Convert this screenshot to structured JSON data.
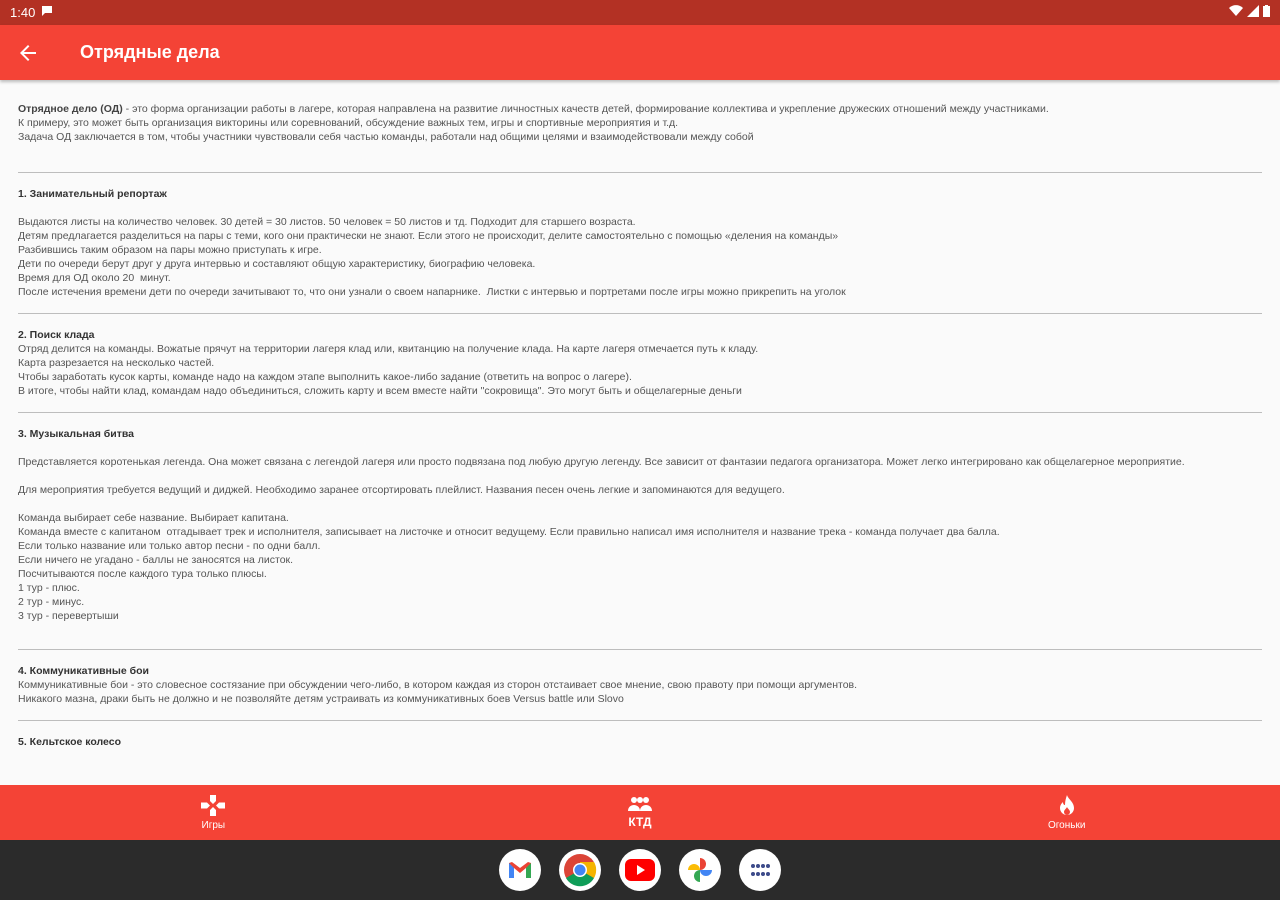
{
  "status_bar": {
    "time": "1:40"
  },
  "app_bar": {
    "title": "Отрядные дела"
  },
  "intro": {
    "term": "Отрядное дело (ОД)",
    "line1_rest": " - это форма организации работы в лагере, которая направлена на развитие личностных качеств детей, формирование коллектива и укрепление дружеских отношений между участниками.",
    "line2": "К примеру, это может быть организация викторины или соревнований, обсуждение важных тем, игры и спортивные мероприятия и т.д.",
    "line3": "Задача ОД заключается в том, чтобы участники чувствовали себя частью команды, работали над общими целями и взаимодействовали между собой"
  },
  "sections": [
    {
      "title": "1.  Занимательный репортаж",
      "lines": [
        "Выдаются листы на количество человек. 30 детей = 30 листов. 50 человек = 50 листов и тд. Подходит для старшего возраста.",
        "Детям предлагается разделиться на пары с теми, кого они практически не знают. Если этого не происходит, делите самостоятельно с помощью «деления на команды»",
        "Разбившись таким образом на пары можно приступать к игре.",
        "Дети по очереди берут друг у друга интервью и составляют общую характеристику, биографию человека.",
        "Время для ОД около 20  минут.",
        "После истечения времени дети по очереди зачитывают то, что они узнали о своем напарнике.  Листки с интервью и портретами после игры можно прикрепить на уголок"
      ]
    },
    {
      "title": "2. Поиск клада",
      "lines": [
        "Отряд делится на команды. Вожатые прячут на территории лагеря клад или, квитанцию на получение клада. На карте лагеря отмечается путь к кладу.",
        "Карта разрезается на несколько частей.",
        "Чтобы заработать кусок карты, команде надо на каждом этапе выполнить какое-либо задание (ответить на вопрос о лагере).",
        "В итоге, чтобы найти клад, командам надо объединиться, сложить карту и всем вместе найти \"сокровища\". Это могут быть и общелагерные деньги"
      ]
    },
    {
      "title": "3. Музыкальная битва",
      "p1": "Представляется коротенькая легенда. Она может связана с легендой лагеря или просто подвязана под любую другую легенду. Все зависит от фантазии педагога организатора. Может легко интегрировано как общелагерное мероприятие.",
      "p2": "Для мероприятия требуется ведущий и диджей. Необходимо заранее отсортировать плейлист. Названия песен очень легкие и запоминаются для ведущего.",
      "lines": [
        "Команда выбирает себе название. Выбирает капитана.",
        "Команда вместе с капитаном  отгадывает трек и исполнителя, записывает на листочке и относит ведущему. Если правильно написал имя исполнителя и название трека - команда получает два балла.",
        "Если только название или только автор песни - по одни балл.",
        "Если ничего не угадано - баллы не заносятся на листок.",
        "Посчитываются после каждого тура только плюсы.",
        "1 тур - плюс.",
        "2 тур - минус.",
        "3 тур - перевертыши"
      ]
    },
    {
      "title": "4. Коммуникативные бои",
      "lines": [
        "Коммуникативные бои - это словесное состязание при обсуждении чего-либо, в котором каждая из сторон отстаивает свое мнение, свою правоту при помощи аргументов.",
        "Никакого мазна, драки быть не должно и не позволяйте детям устраивать из коммуникативных боев Versus battle или Slovo"
      ]
    },
    {
      "title": "5. Кельтское колесо",
      "lines": []
    }
  ],
  "bottom_nav": [
    {
      "label": "Игры",
      "icon": "gamepad-icon"
    },
    {
      "label": "КТД",
      "icon": "group-icon"
    },
    {
      "label": "Огоньки",
      "icon": "fire-icon"
    }
  ],
  "dock": [
    "gmail-icon",
    "chrome-icon",
    "youtube-icon",
    "photos-icon",
    "apps-icon"
  ],
  "colors": {
    "primary": "#f44336",
    "status": "#b33124"
  }
}
